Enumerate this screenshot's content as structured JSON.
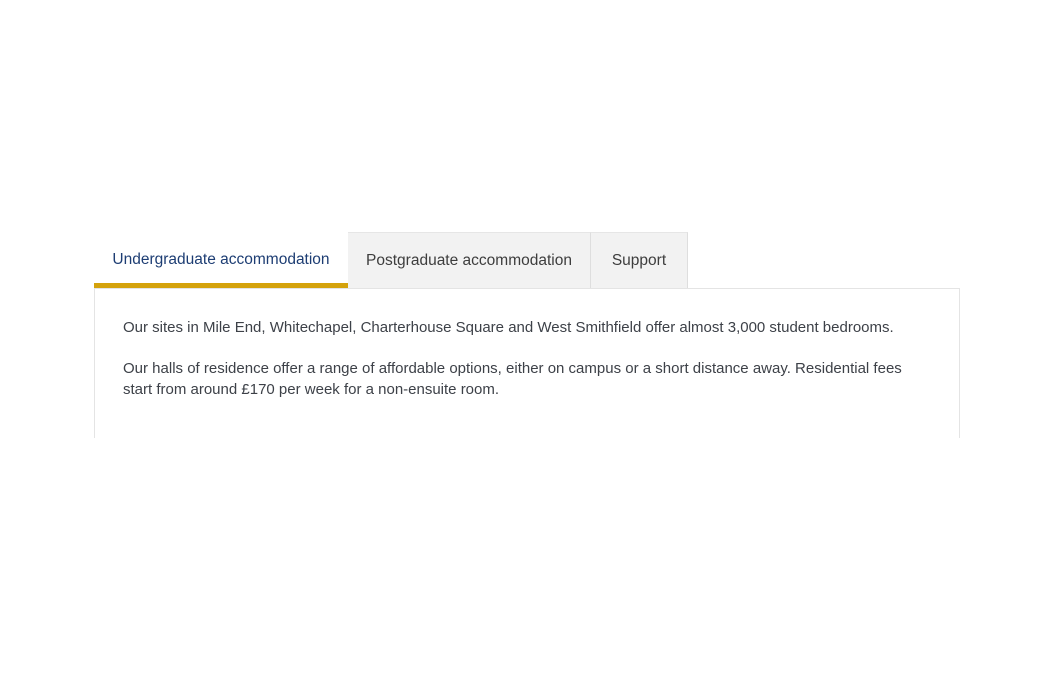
{
  "tabs": [
    {
      "label": "Undergraduate accommodation",
      "active": true
    },
    {
      "label": "Postgraduate accommodation",
      "active": false
    },
    {
      "label": "Support",
      "active": false
    }
  ],
  "panel": {
    "paragraphs": [
      "Our sites in Mile End, Whitechapel, Charterhouse Square and West Smithfield offer almost 3,000 student bedrooms.",
      "Our halls of residence offer a range of affordable options, either on campus or a short distance away. Residential fees start from around £170 per week for a non-ensuite room."
    ]
  },
  "colors": {
    "active_tab_text": "#1d3d73",
    "active_tab_underline": "#d4a20c",
    "inactive_tab_background": "#f2f2f2",
    "body_text": "#3d4148"
  }
}
